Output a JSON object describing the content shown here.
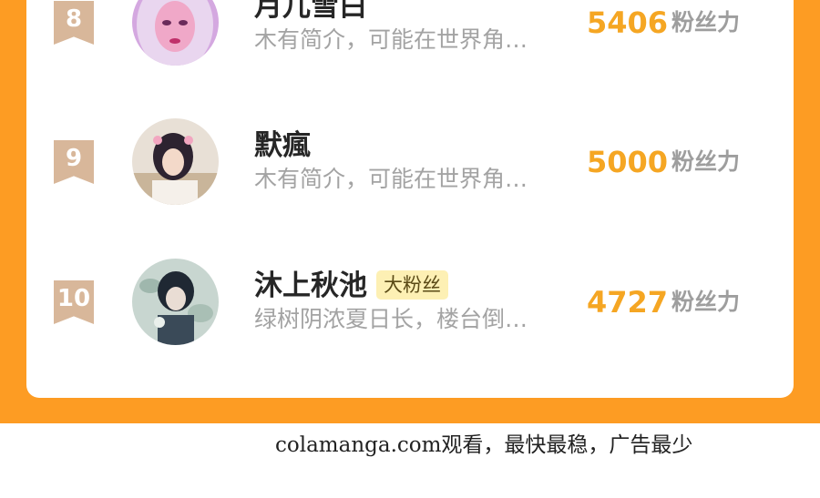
{
  "rankings": [
    {
      "rank": "8",
      "name": "月儿雪白",
      "badge": "",
      "desc": "木有简介，可能在世界角…",
      "score": "5406",
      "unit": "粉丝力"
    },
    {
      "rank": "9",
      "name": "默瘋",
      "badge": "",
      "desc": "木有简介，可能在世界角…",
      "score": "5000",
      "unit": "粉丝力"
    },
    {
      "rank": "10",
      "name": "沐上秋池",
      "badge": "大粉丝",
      "desc": "绿树阴浓夏日长，楼台倒…",
      "score": "4727",
      "unit": "粉丝力"
    }
  ],
  "footer": {
    "text": "colamanga.com观看，最快最稳，广告最少"
  },
  "colors": {
    "background": "#fd9c23",
    "score": "#f5a623",
    "rank_badge": "#d8b79a",
    "fan_badge": "#fdf0b4"
  }
}
